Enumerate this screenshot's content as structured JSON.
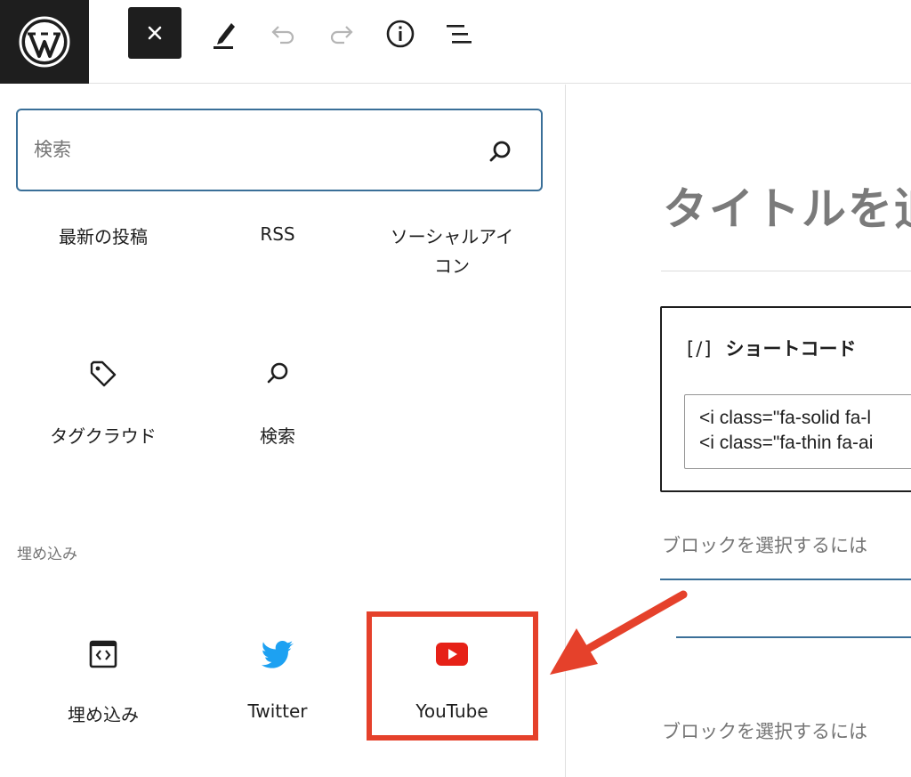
{
  "toolbar": {
    "wp_logo_icon": "wordpress-logo-icon",
    "close_icon": "close-icon",
    "tools": [
      "edit-pencil-icon",
      "undo-icon",
      "redo-icon",
      "info-icon",
      "list-view-icon"
    ]
  },
  "inserter": {
    "search": {
      "placeholder": "検索",
      "value": ""
    },
    "widget_blocks": [
      {
        "label": "最新の投稿"
      },
      {
        "label": "RSS"
      },
      {
        "label_line1": "ソーシャルアイ",
        "label_line2": "コン"
      },
      {
        "label": "タグクラウド",
        "icon": "tag-icon"
      },
      {
        "label": "検索",
        "icon": "search-icon"
      }
    ],
    "embed_category": "埋め込み",
    "embed_blocks": [
      {
        "label": "埋め込み",
        "icon": "embed-icon"
      },
      {
        "label": "Twitter",
        "icon": "twitter-icon"
      },
      {
        "label": "YouTube",
        "icon": "youtube-icon"
      }
    ]
  },
  "editor": {
    "title": "タイトルを追",
    "shortcode": {
      "bracket": "[/]",
      "label": "ショートコード",
      "content": "<i class=\"fa-solid fa-l\n<i class=\"fa-thin fa-ai"
    },
    "block_placeholder": "ブロックを選択するには"
  },
  "colors": {
    "accent": "#3a6f98",
    "highlight": "#e5412b",
    "youtube": "#e62117",
    "twitter": "#1da1f2",
    "dark": "#1e1e1e"
  }
}
